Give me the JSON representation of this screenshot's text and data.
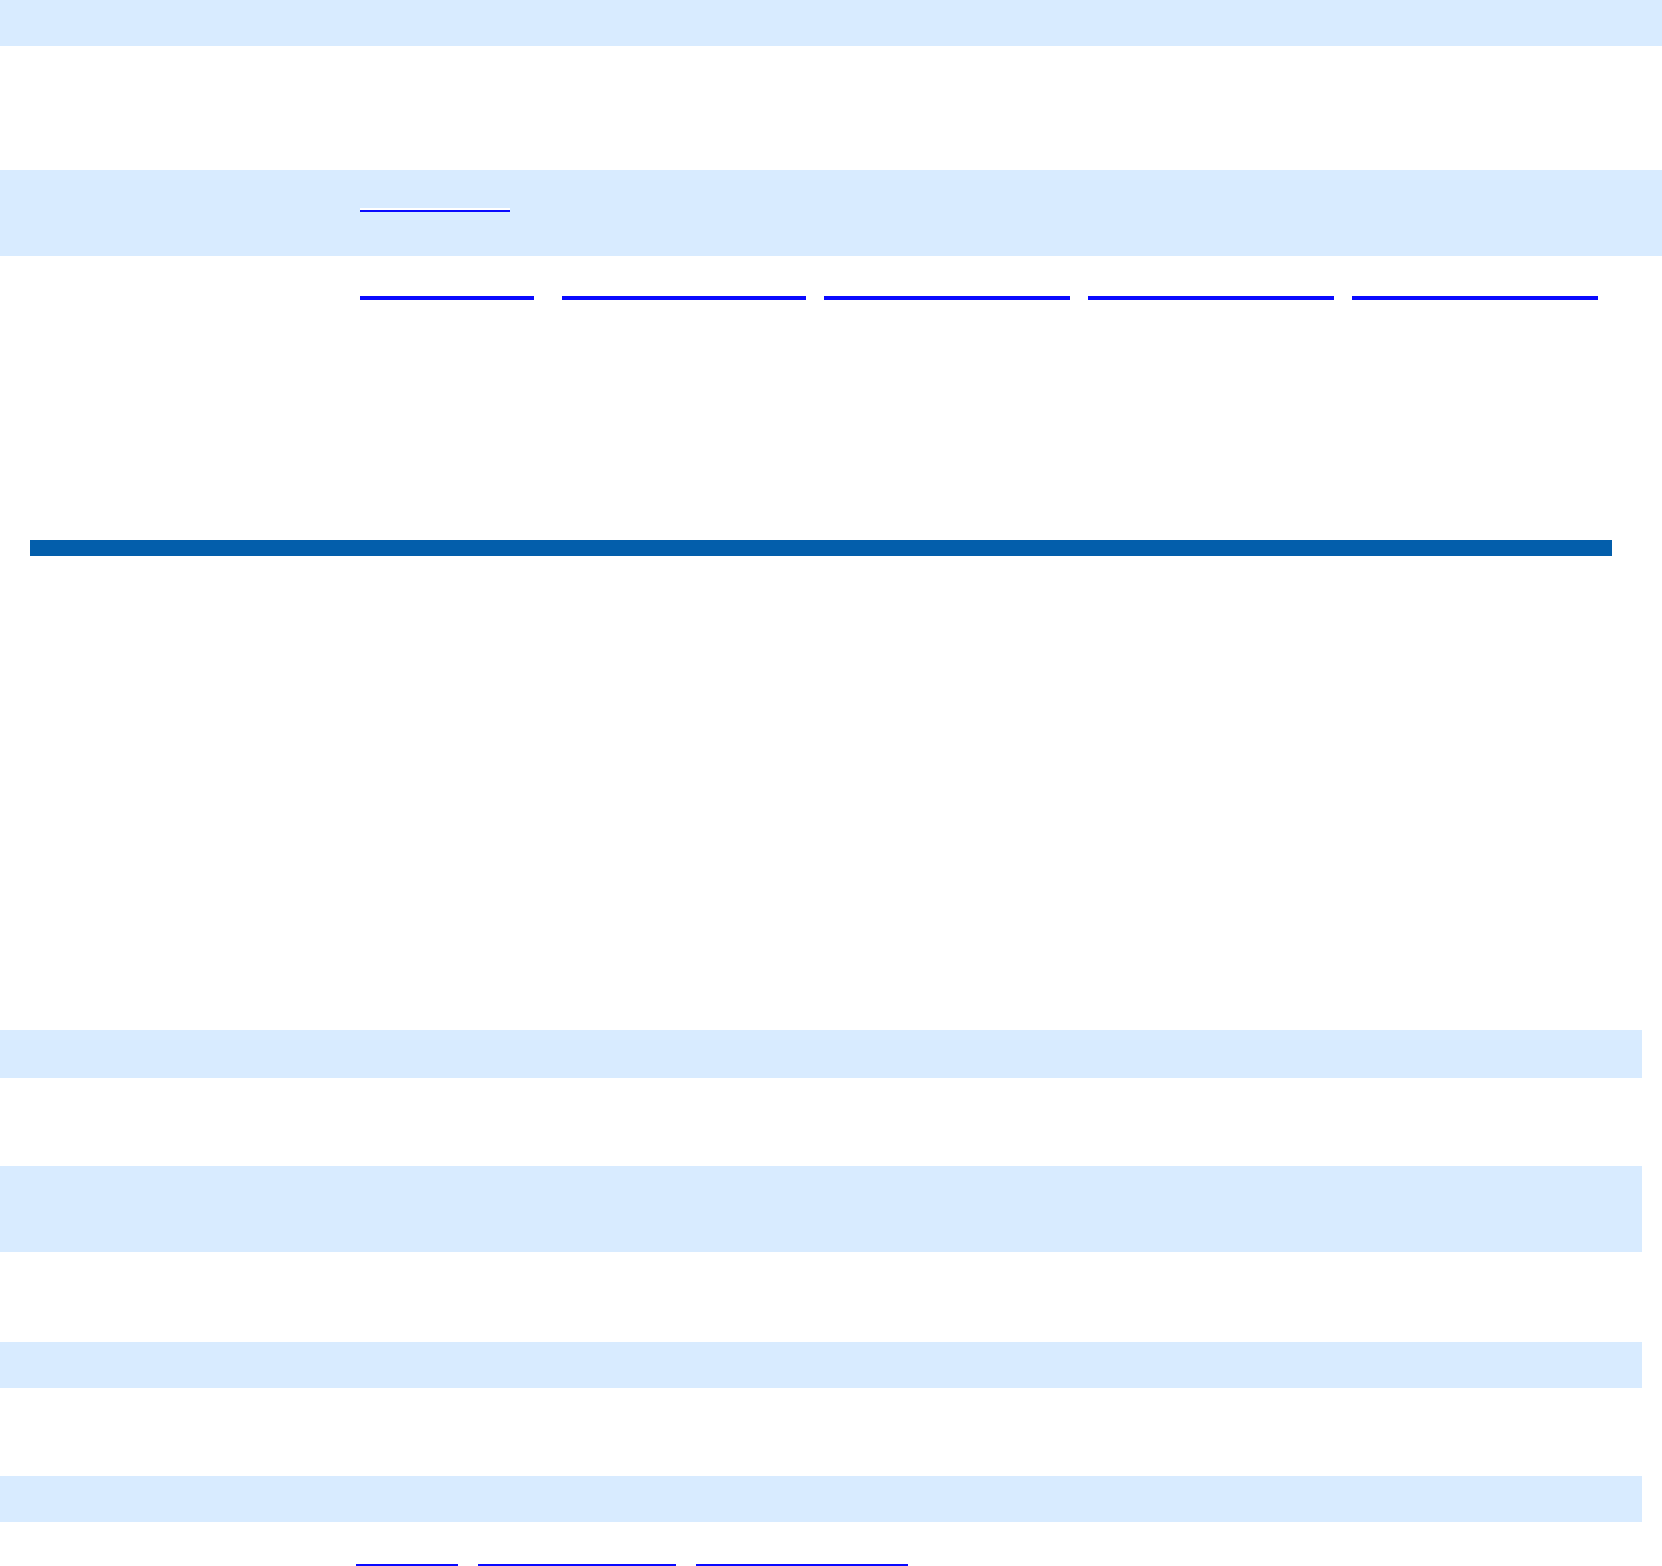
{
  "top_table": {
    "rows": [
      {
        "shaded": true
      },
      {
        "shaded": false
      },
      {
        "shaded": true,
        "links": [
          {
            "underlined": true
          }
        ]
      },
      {
        "shaded": false,
        "links": [
          {
            "underlined": true
          },
          {
            "underlined": true
          },
          {
            "underlined": true
          },
          {
            "underlined": true
          },
          {
            "underlined": true
          }
        ]
      }
    ]
  },
  "bottom_table": {
    "rows": [
      {
        "shaded": true
      },
      {
        "shaded": false
      },
      {
        "shaded": true
      },
      {
        "shaded": false
      },
      {
        "shaded": true
      },
      {
        "shaded": false
      },
      {
        "shaded": true
      },
      {
        "shaded": false,
        "links": [
          {
            "underlined": true
          },
          {
            "underlined": true
          },
          {
            "underlined": true
          }
        ]
      }
    ]
  }
}
